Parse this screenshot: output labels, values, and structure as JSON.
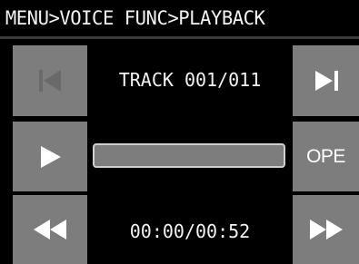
{
  "header": {
    "breadcrumb": "MENU>VOICE FUNC>PLAYBACK"
  },
  "player": {
    "track_label": "TRACK 001/011",
    "time_label": "00:00/00:52",
    "progress_fraction": 0.0,
    "ope_label": "OPE"
  },
  "icons": {
    "prev": "skip-previous-icon",
    "next": "skip-next-icon",
    "play": "play-icon",
    "rewind": "rewind-icon",
    "fast_forward": "fast-forward-icon"
  },
  "colors": {
    "background": "#000000",
    "button": "#7d7d7d",
    "icon": "#ffffff",
    "icon_disabled": "#6a6a6a",
    "text": "#f2f2f2"
  }
}
